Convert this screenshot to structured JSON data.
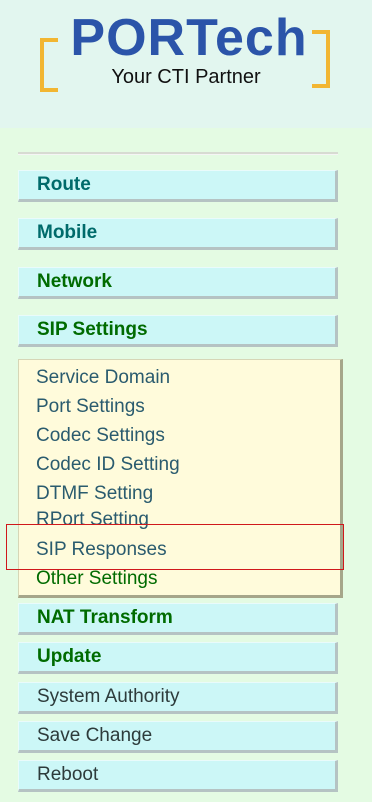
{
  "logo": {
    "brand": "PORTech",
    "tagline": "Your CTI Partner"
  },
  "menu": {
    "route": "Route",
    "mobile": "Mobile",
    "network": "Network",
    "sip_settings": "SIP Settings",
    "sip_submenu": [
      "Service Domain",
      "Port Settings",
      "Codec Settings",
      "Codec ID Setting",
      "DTMF Setting",
      "RPort Setting",
      "SIP Responses",
      "Other Settings"
    ],
    "nat_transform": "NAT Transform",
    "update": "Update",
    "system_authority": "System Authority",
    "save_change": "Save Change",
    "reboot": "Reboot"
  },
  "colors": {
    "page_bg": "#e4fbe3",
    "header_bg": "#e2f6ef",
    "menu_button_bg": "#ccf7f7",
    "submenu_bg": "#fffbdb",
    "highlight_border": "#d0181b",
    "brand_blue": "#2b54a9",
    "bracket_gold": "#f2b632"
  },
  "selected_item": "SIP Responses"
}
